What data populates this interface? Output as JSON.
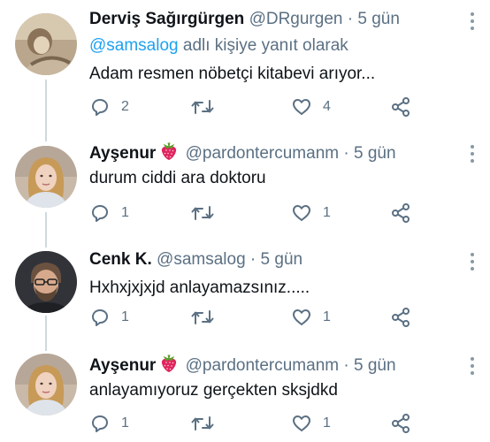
{
  "tweets": [
    {
      "name": "Derviş Sağırgürgen",
      "handle": "@DRgurgen",
      "separator": "·",
      "time": "5 gün",
      "reply_to_handle": "@samsalog",
      "reply_to_suffix": " adlı kişiye yanıt olarak",
      "text": "Adam resmen nöbetçi kitabevi arıyor...",
      "replies": "2",
      "retweets": "",
      "likes": "4",
      "emoji": ""
    },
    {
      "name": "Ayşenur",
      "emoji": "strawberry-emoji",
      "handle": "@pardontercumanm",
      "separator": "·",
      "time": "5 gün",
      "text": "durum ciddi ara doktoru",
      "replies": "1",
      "retweets": "",
      "likes": "1"
    },
    {
      "name": "Cenk K.",
      "handle": "@samsalog",
      "separator": "·",
      "time": "5 gün",
      "text": "Hxhxjxjxjd anlayamazsınız.....",
      "replies": "1",
      "retweets": "",
      "likes": "1",
      "emoji": ""
    },
    {
      "name": "Ayşenur",
      "emoji": "strawberry-emoji",
      "handle": "@pardontercumanm",
      "separator": "·",
      "time": "5 gün",
      "text": "anlayamıyoruz gerçekten sksjdkd",
      "replies": "1",
      "retweets": "",
      "likes": "1"
    }
  ],
  "colors": {
    "text": "#0f1419",
    "muted": "#5b7083",
    "link": "#1da1f2",
    "thread_line": "#cfd9de",
    "strawberry": "#e0245e"
  },
  "icons": [
    "reply-icon",
    "retweet-icon",
    "like-icon",
    "share-icon",
    "more-icon",
    "strawberry-emoji"
  ]
}
